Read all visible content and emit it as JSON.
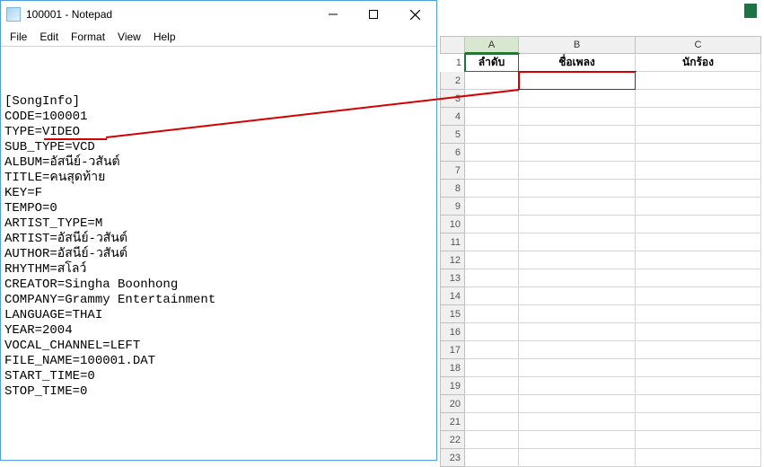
{
  "notepad": {
    "title": "100001 - Notepad",
    "menu": {
      "file": "File",
      "edit": "Edit",
      "format": "Format",
      "view": "View",
      "help": "Help"
    },
    "lines": [
      "[SongInfo]",
      "CODE=100001",
      "TYPE=VIDEO",
      "SUB_TYPE=VCD",
      "ALBUM=อัสนีย์-วสันต์",
      "TITLE=คนสุดท้าย",
      "KEY=F",
      "TEMPO=0",
      "ARTIST_TYPE=M",
      "ARTIST=อัสนีย์-วสันต์",
      "AUTHOR=อัสนีย์-วสันต์",
      "RHYTHM=สโลว์",
      "CREATOR=Singha Boonhong",
      "COMPANY=Grammy Entertainment",
      "LANGUAGE=THAI",
      "YEAR=2004",
      "VOCAL_CHANNEL=LEFT",
      "FILE_NAME=100001.DAT",
      "START_TIME=0",
      "STOP_TIME=0"
    ]
  },
  "sheet": {
    "cols": {
      "A": "A",
      "B": "B",
      "C": "C"
    },
    "headers": {
      "A": "ลำดับ",
      "B": "ชื่อเพลง",
      "C": "นักร้อง"
    },
    "rownums": [
      "1",
      "2",
      "3",
      "4",
      "5",
      "6",
      "7",
      "8",
      "9",
      "10",
      "11",
      "12",
      "13",
      "14",
      "15",
      "16",
      "17",
      "18",
      "19",
      "20",
      "21",
      "22",
      "23"
    ]
  }
}
